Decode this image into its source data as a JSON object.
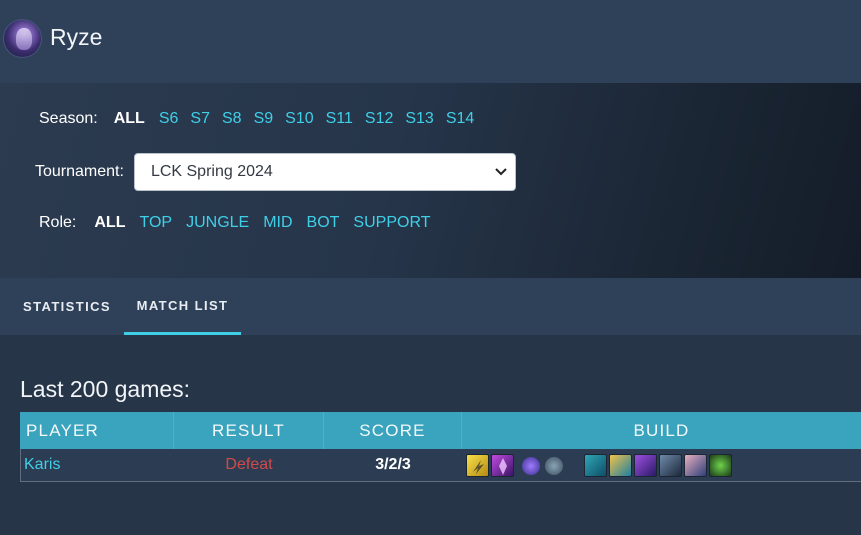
{
  "header": {
    "champion_name": "Ryze"
  },
  "filters": {
    "season": {
      "label": "Season:",
      "options": [
        "ALL",
        "S6",
        "S7",
        "S8",
        "S9",
        "S10",
        "S11",
        "S12",
        "S13",
        "S14"
      ],
      "active": "ALL"
    },
    "tournament": {
      "label": "Tournament:",
      "selected": "LCK Spring 2024"
    },
    "role": {
      "label": "Role:",
      "options": [
        "ALL",
        "TOP",
        "JUNGLE",
        "MID",
        "BOT",
        "SUPPORT"
      ],
      "active": "ALL"
    }
  },
  "tabs": [
    {
      "label": "STATISTICS",
      "active": false
    },
    {
      "label": "MATCH LIST",
      "active": true
    }
  ],
  "main": {
    "title": "Last 200 games:",
    "table": {
      "headers": [
        "PLAYER",
        "RESULT",
        "SCORE",
        "BUILD"
      ],
      "rows": [
        {
          "player": "Karis",
          "result": "Defeat",
          "score": "3/2/3",
          "build": {
            "summoners": [
              "flash-icon",
              "teleport-icon"
            ],
            "runes": [
              "keystone-rune-icon",
              "secondary-rune-icon"
            ],
            "items": [
              "item-1-icon",
              "item-2-icon",
              "item-3-icon",
              "item-4-icon",
              "item-5-icon",
              "item-6-icon"
            ]
          }
        }
      ]
    }
  },
  "colors": {
    "accent": "#3fd0e8",
    "header_bg": "#2f4059",
    "table_header": "#3aa3bd",
    "defeat": "#d24a4a"
  }
}
